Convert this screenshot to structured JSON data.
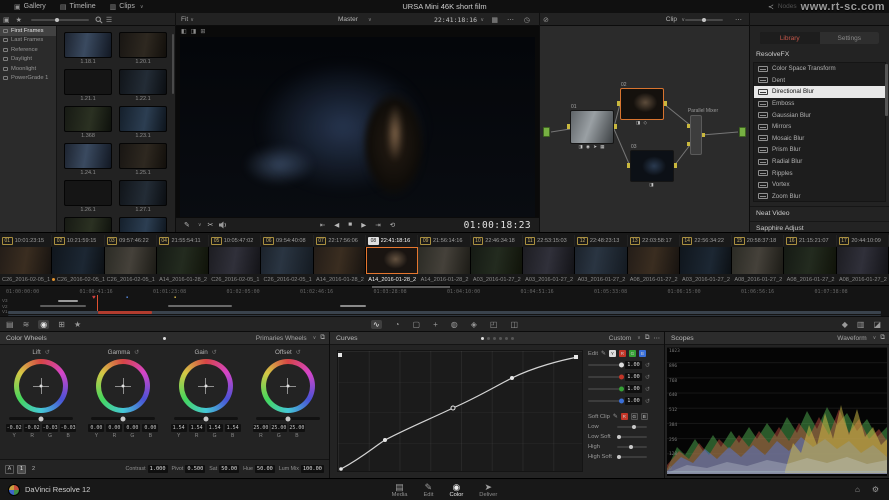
{
  "icons": {
    "gallery": "▣",
    "timeline": "▤",
    "clips": "▥",
    "chevron": "∨",
    "share": "≺",
    "grid": "▦",
    "dots": "⋯",
    "clock": "◷",
    "bypass": "⊘",
    "wipe_a": "◧",
    "wipe_b": "◨",
    "both": "⊞",
    "pen": "✎",
    "scissors": "✂",
    "skip_start": "⇤",
    "step_back": "◀",
    "stop": "■",
    "play": "▶",
    "skip_end": "⇥",
    "loop": "⟲",
    "list": "☰",
    "reset": "↺",
    "star": "★",
    "dot": "•",
    "heart": "♥",
    "marker": "▪",
    "expand": "⧉",
    "cam_raw": "▤",
    "color_match": "≋",
    "wheels": "◉",
    "rgb_mixer": "⊞",
    "motion": "★",
    "curves": "∿",
    "qualifier": "◔",
    "window": "▢",
    "tracker": "+",
    "blur": "◍",
    "key": "◈",
    "sizing": "◰",
    "stereo": "◫",
    "keyframes": "◆",
    "scope_ic": "▥",
    "info": "◪",
    "home": "⌂",
    "gear": "⚙",
    "page_media": "▤",
    "page_edit": "✎",
    "page_color": "◉",
    "page_deliver": "➤"
  },
  "top_bar": {
    "gallery": "Gallery",
    "timeline": "Timeline",
    "clips": "Clips",
    "title": "URSA Mini 46K short film",
    "nodes": "Nodes",
    "watermark": "www.rt-sc.com"
  },
  "viewer": {
    "fit": "Fit",
    "master": "Master",
    "source_tc": "22:41:18:16",
    "current_tc": "01:00:18:23"
  },
  "node_graph": {
    "clip": "Clip",
    "mixer": "Parallel Mixer",
    "nodes": [
      {
        "id": "01",
        "tools": "◨ ◉ ➤ ▦"
      },
      {
        "id": "02",
        "tools": "◨ ◇"
      },
      {
        "id": "03",
        "tools": "◨"
      }
    ]
  },
  "gallery": {
    "folders": [
      {
        "label": "First Frames",
        "active": true
      },
      {
        "label": "Last Frames"
      },
      {
        "label": "Reference"
      },
      {
        "label": "Daylight"
      },
      {
        "label": "Moonlight"
      },
      {
        "label": "PowerGrade 1"
      }
    ],
    "stills": [
      {
        "label": "1.18.1"
      },
      {
        "label": "1.20.1"
      },
      {
        "label": "1.21.1"
      },
      {
        "label": "1.22.1"
      },
      {
        "label": "1.368"
      },
      {
        "label": "1.23.1"
      },
      {
        "label": "1.24.1"
      },
      {
        "label": "1.25.1"
      },
      {
        "label": "1.26.1"
      },
      {
        "label": "1.27.1"
      },
      {
        "label": ""
      },
      {
        "label": ""
      }
    ]
  },
  "openfx": {
    "tab_library": "Library",
    "tab_settings": "Settings",
    "section_resolvefx": "ResolveFX",
    "items": [
      {
        "label": "Color Space Transform"
      },
      {
        "label": "Dent"
      },
      {
        "label": "Directional Blur",
        "selected": true
      },
      {
        "label": "Emboss"
      },
      {
        "label": "Gaussian Blur"
      },
      {
        "label": "Mirrors"
      },
      {
        "label": "Mosaic Blur"
      },
      {
        "label": "Prism Blur"
      },
      {
        "label": "Radial Blur"
      },
      {
        "label": "Ripples"
      },
      {
        "label": "Vortex"
      },
      {
        "label": "Zoom Blur"
      }
    ],
    "section_neat": "Neat Video",
    "section_sapphire": "Sapphire Adjust"
  },
  "timeline": {
    "clips": [
      {
        "num": "01",
        "tc": "10:01:23:15",
        "name": "C26_2016-02-05_1"
      },
      {
        "num": "02",
        "tc": "10:21:59:15",
        "name": "C26_2016-02-05_1",
        "flagged": true
      },
      {
        "num": "03",
        "tc": "09:57:46:22",
        "name": "C26_2016-02-05_1"
      },
      {
        "num": "04",
        "tc": "21:55:54:11",
        "name": "A14_2016-01-28_2"
      },
      {
        "num": "05",
        "tc": "10:05:47:02",
        "name": "C26_2016-02-05_1"
      },
      {
        "num": "06",
        "tc": "09:54:40:08",
        "name": "C26_2016-02-05_1"
      },
      {
        "num": "07",
        "tc": "22:17:56:06",
        "name": "A14_2016-01-28_2"
      },
      {
        "num": "08",
        "tc": "22:41:18:16",
        "name": "A14_2016-01-28_2",
        "current": true
      },
      {
        "num": "09",
        "tc": "21:56:14:16",
        "name": "A14_2016-01-28_2"
      },
      {
        "num": "10",
        "tc": "22:46:34:18",
        "name": "A03_2016-01-27_2"
      },
      {
        "num": "11",
        "tc": "22:53:15:03",
        "name": "A03_2016-01-27_2"
      },
      {
        "num": "12",
        "tc": "22:48:23:13",
        "name": "A03_2016-01-27_2"
      },
      {
        "num": "13",
        "tc": "22:03:58:17",
        "name": "A08_2016-01-27_2"
      },
      {
        "num": "14",
        "tc": "22:56:34:22",
        "name": "A03_2016-01-27_2"
      },
      {
        "num": "15",
        "tc": "20:58:37:18",
        "name": "A08_2016-01-27_2"
      },
      {
        "num": "16",
        "tc": "21:15:21:07",
        "name": "A08_2016-01-27_2"
      },
      {
        "num": "17",
        "tc": "20:44:10:09",
        "name": "A08_2016-01-27_2"
      }
    ],
    "ruler": [
      "01:00:00:00",
      "01:00:41:16",
      "01:01:23:08",
      "01:02:05:00",
      "01:02:46:16",
      "01:03:28:08",
      "01:04:10:00",
      "01:04:51:16",
      "01:05:33:08",
      "01:06:15:00",
      "01:06:56:16",
      "01:07:38:08"
    ],
    "tracks": [
      "V3",
      "V2",
      "V1"
    ]
  },
  "wheels": {
    "header": "Color Wheels",
    "mode": "Primaries Wheels",
    "items": [
      {
        "name": "Lift",
        "values": [
          "-0.02",
          "-0.02",
          "-0.03",
          "-0.03"
        ],
        "letters": [
          "Y",
          "R",
          "G",
          "B"
        ]
      },
      {
        "name": "Gamma",
        "values": [
          "0.00",
          "0.00",
          "0.00",
          "0.00"
        ],
        "letters": [
          "Y",
          "R",
          "G",
          "B"
        ]
      },
      {
        "name": "Gain",
        "values": [
          "1.54",
          "1.54",
          "1.54",
          "1.54"
        ],
        "letters": [
          "Y",
          "R",
          "G",
          "B"
        ]
      },
      {
        "name": "Offset",
        "values": [
          "25.00",
          "25.00",
          "25.00"
        ],
        "letters": [
          "R",
          "G",
          "B"
        ],
        "triple": true
      }
    ],
    "bottom": {
      "a": "A",
      "g1": "1",
      "g2": "2",
      "fields": [
        {
          "label": "Contrast",
          "value": "1.000"
        },
        {
          "label": "Pivot",
          "value": "0.500"
        },
        {
          "label": "Sat",
          "value": "50.00"
        },
        {
          "label": "Hue",
          "value": "50.00"
        },
        {
          "label": "Lum Mix",
          "value": "100.00"
        }
      ]
    }
  },
  "curves": {
    "header": "Curves",
    "mode": "Custom",
    "edit": "Edit",
    "channels": [
      "Y",
      "R",
      "G",
      "B"
    ],
    "sliders": [
      {
        "value": "1.00"
      },
      {
        "value": "1.00"
      },
      {
        "value": "1.00"
      },
      {
        "value": "1.00"
      }
    ],
    "soft_clip": "Soft Clip",
    "soft_channels": [
      "R",
      "G",
      "B"
    ],
    "soft_rows": [
      {
        "label": "Low"
      },
      {
        "label": "Low Soft"
      },
      {
        "label": "High"
      },
      {
        "label": "High Soft"
      }
    ]
  },
  "scopes": {
    "header": "Scopes",
    "mode": "Waveform",
    "scale": [
      "1023",
      "896",
      "768",
      "640",
      "512",
      "384",
      "256",
      "128",
      "0"
    ]
  },
  "bottom_bar": {
    "app": "DaVinci Resolve 12",
    "pages": [
      {
        "label": "Media",
        "icon_key": "page_media"
      },
      {
        "label": "Edit",
        "icon_key": "page_edit"
      },
      {
        "label": "Color",
        "icon_key": "page_color",
        "active": true
      },
      {
        "label": "Deliver",
        "icon_key": "page_deliver"
      }
    ]
  }
}
